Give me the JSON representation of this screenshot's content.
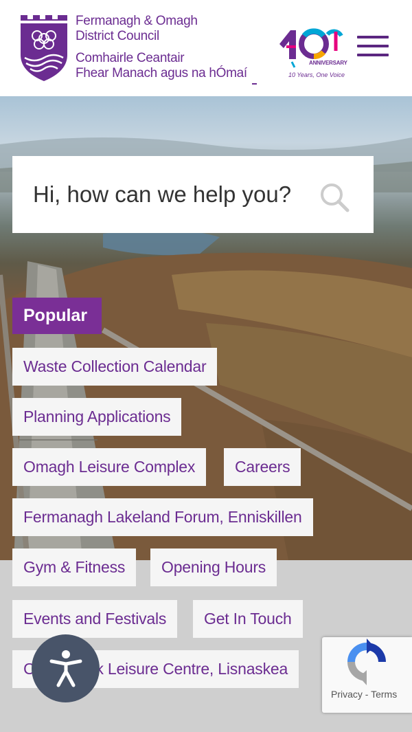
{
  "header": {
    "council_name_en_line1": "Fermanagh & Omagh",
    "council_name_en_line2": "District Council",
    "council_name_ga_line1": "Comhairle Ceantair",
    "council_name_ga_line2": "Fhear Manach agus na hÓmaí",
    "anniversary_label": "ANNIVERSARY",
    "anniversary_tagline": "10 Years, One Voice",
    "brand_color": "#6b2c91"
  },
  "search": {
    "placeholder": "Hi, how can we help you?"
  },
  "popular": {
    "heading": "Popular",
    "links": [
      "Waste Collection Calendar",
      "Planning Applications",
      "Omagh Leisure Complex",
      "Careers",
      "Fermanagh Lakeland Forum, Enniskillen",
      "Gym & Fitness",
      "Opening Hours",
      "Events and Festivals",
      "Get In Touch",
      "Castle Park Leisure Centre, Lisnaskea"
    ]
  },
  "recaptcha": {
    "privacy": "Privacy",
    "separator": " - ",
    "terms": "Terms"
  },
  "icons": {
    "menu": "hamburger-menu-icon",
    "search": "search-icon",
    "accessibility": "accessibility-icon",
    "recaptcha": "recaptcha-icon"
  }
}
